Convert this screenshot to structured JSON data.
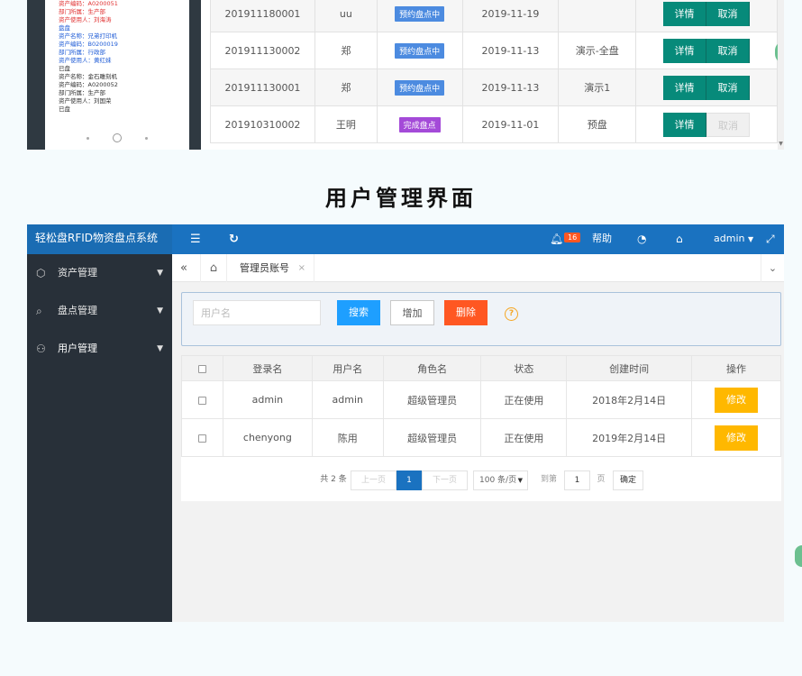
{
  "top_fragment": {
    "phone_lines": [
      {
        "text": "资产编码：A0200051",
        "tone": "red"
      },
      {
        "text": "部门所属：生产部",
        "tone": "red"
      },
      {
        "text": "资产使用人：刘海涛",
        "tone": "red"
      },
      {
        "text": "盘盘",
        "tone": "blue"
      },
      {
        "text": "资产名称：兄弟打印机",
        "tone": "blue"
      },
      {
        "text": "资产编码：B0200019",
        "tone": "blue"
      },
      {
        "text": "部门所属：行政部",
        "tone": "blue"
      },
      {
        "text": "资产使用人：黄红妹",
        "tone": "blue"
      },
      {
        "text": "已盘",
        "tone": "dark"
      },
      {
        "text": "资产名称：金石雕刻机",
        "tone": "dark"
      },
      {
        "text": "资产编码：A0200052",
        "tone": "dark"
      },
      {
        "text": "部门所属：生产部",
        "tone": "dark"
      },
      {
        "text": "资产使用人：刘国荣",
        "tone": "dark"
      },
      {
        "text": "已盘",
        "tone": "dark"
      }
    ],
    "tasks": [
      {
        "code": "201911180001",
        "user": "uu",
        "status": "预约盘点中",
        "status_color": "#4c8be0",
        "date": "2019-11-19",
        "name": "",
        "detail": "详情",
        "cancel": "取消",
        "cancel_disabled": false
      },
      {
        "code": "201911130002",
        "user": "郑",
        "status": "预约盘点中",
        "status_color": "#4c8be0",
        "date": "2019-11-13",
        "name": "演示-全盘",
        "detail": "详情",
        "cancel": "取消",
        "cancel_disabled": false
      },
      {
        "code": "201911130001",
        "user": "郑",
        "status": "预约盘点中",
        "status_color": "#4c8be0",
        "date": "2019-11-13",
        "name": "演示1",
        "detail": "详情",
        "cancel": "取消",
        "cancel_disabled": false
      },
      {
        "code": "201910310002",
        "user": "王明",
        "status": "完成盘点",
        "status_color": "#a44ad8",
        "date": "2019-11-01",
        "name": "预盘",
        "detail": "详情",
        "cancel": "取消",
        "cancel_disabled": true
      }
    ]
  },
  "heading": "用户管理界面",
  "app": {
    "brand": "轻松盘RFID物资盘点系统",
    "topbar": {
      "badge_count": "16",
      "help": "帮助",
      "user": "admin"
    },
    "sidebar": [
      {
        "label": "资产管理",
        "icon": "cube-icon"
      },
      {
        "label": "盘点管理",
        "icon": "magnifier-icon"
      },
      {
        "label": "用户管理",
        "icon": "users-icon"
      }
    ],
    "tab": {
      "label": "管理员账号"
    },
    "search": {
      "placeholder": "用户名",
      "search_label": "搜索",
      "add_label": "增加",
      "delete_label": "删除"
    },
    "table": {
      "headers": [
        "登录名",
        "用户名",
        "角色名",
        "状态",
        "创建时间",
        "操作"
      ],
      "rows": [
        {
          "login": "admin",
          "name": "admin",
          "role": "超级管理员",
          "status": "正在使用",
          "created": "2018年2月14日",
          "action": "修改"
        },
        {
          "login": "chenyong",
          "name": "陈用",
          "role": "超级管理员",
          "status": "正在使用",
          "created": "2019年2月14日",
          "action": "修改"
        }
      ]
    },
    "pager": {
      "total": "共 2 条",
      "prev": "上一页",
      "current": "1",
      "next": "下一页",
      "page_size": "100 条/页",
      "goto_label": "到第",
      "goto_value": "1",
      "page_unit": "页",
      "confirm": "确定"
    }
  }
}
